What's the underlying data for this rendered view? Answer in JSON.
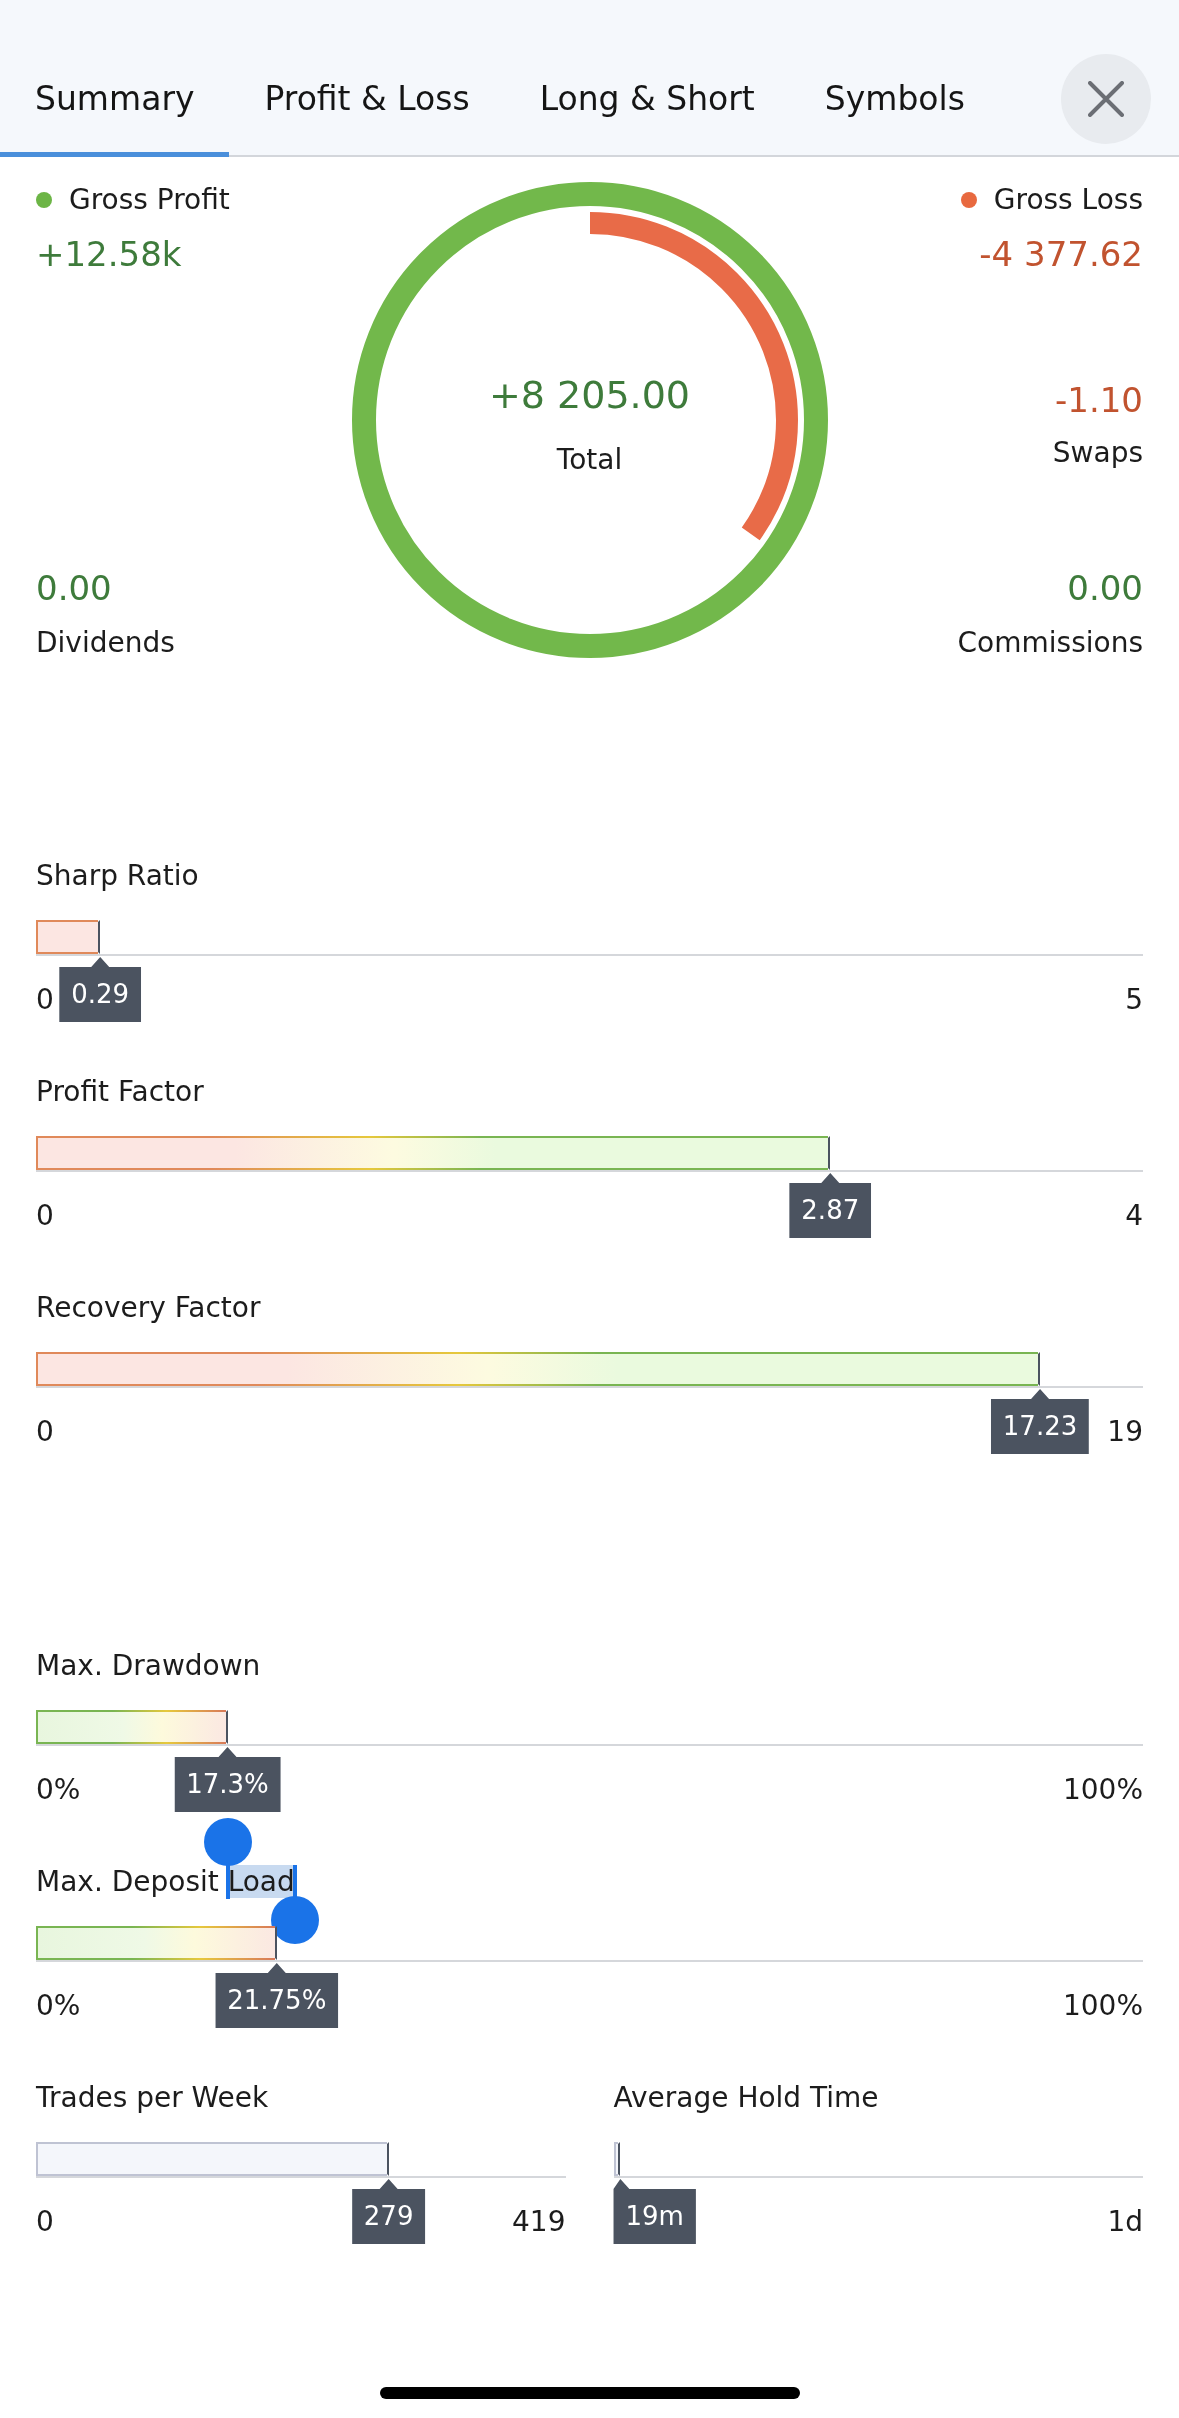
{
  "tabs": [
    {
      "label": "Summary",
      "selected": true
    },
    {
      "label": "Profit & Loss",
      "selected": false
    },
    {
      "label": "Long & Short",
      "selected": false
    },
    {
      "label": "Symbols",
      "selected": false
    }
  ],
  "summary": {
    "gross_profit": {
      "label": "Gross Profit",
      "value": "+12.58k",
      "negative": false,
      "color": "#6cb546"
    },
    "gross_loss": {
      "label": "Gross Loss",
      "value": "-4 377.62",
      "negative": true,
      "color": "#e8693f"
    },
    "total": {
      "value": "+8 205.00",
      "label": "Total",
      "negative": false
    },
    "loss_ring": {
      "level": 0.348
    },
    "swaps": {
      "value": "-1.10",
      "label": "Swaps",
      "negative": true
    },
    "dividends": {
      "value": "0.00",
      "label": "Dividends",
      "negative": false
    },
    "commissions": {
      "value": "0.00",
      "label": "Commissions",
      "negative": false
    }
  },
  "ratios": [
    {
      "kind": "low",
      "label_parts": [
        {
          "text": "Sharp Ratio",
          "selected": false
        }
      ],
      "level": 0.058,
      "value": "0.29",
      "scale_min": "0",
      "scale_max": "5"
    },
    {
      "kind": "rising",
      "label_parts": [
        {
          "text": "Profit Factor",
          "selected": false
        }
      ],
      "level": 0.7175,
      "value": "2.87",
      "scale_min": "0",
      "scale_max": "4"
    },
    {
      "kind": "rising",
      "label_parts": [
        {
          "text": "Recovery Factor",
          "selected": false
        }
      ],
      "level": 0.907,
      "value": "17.23",
      "scale_min": "0",
      "scale_max": "19"
    }
  ],
  "risk": [
    {
      "kind": "falling",
      "label_parts": [
        {
          "text": "Max. Drawdown",
          "selected": false
        }
      ],
      "level": 0.173,
      "value": "17.3%",
      "scale_min": "0%",
      "scale_max": "100%"
    },
    {
      "kind": "falling",
      "label_parts": [
        {
          "text": "Max. Deposit ",
          "selected": false
        },
        {
          "text": "Load",
          "selected": true
        }
      ],
      "level": 0.2175,
      "value": "21.75%",
      "scale_min": "0%",
      "scale_max": "100%"
    }
  ],
  "activity": [
    {
      "kind": "neutral",
      "label_parts": [
        {
          "text": "Trades per Week",
          "selected": false
        }
      ],
      "level": 0.666,
      "value": "279",
      "scale_min": "0",
      "scale_max": "419"
    },
    {
      "kind": "neutral",
      "label_parts": [
        {
          "text": "Average Hold Time",
          "selected": false
        }
      ],
      "level": 0.013,
      "value": "19m",
      "scale_max": "1d"
    }
  ]
}
